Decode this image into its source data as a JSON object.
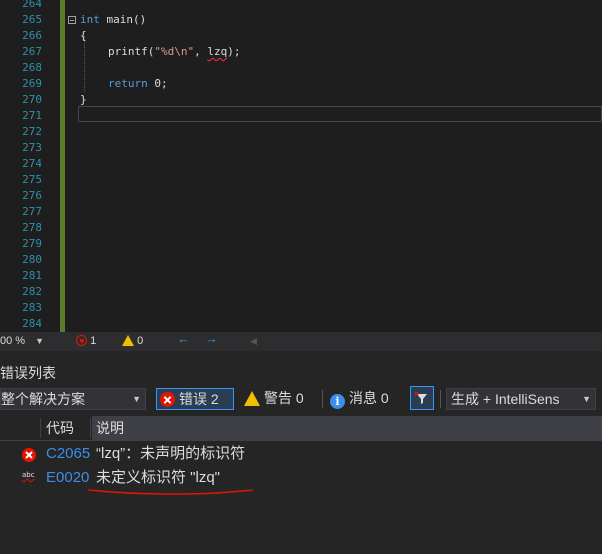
{
  "editor": {
    "line_numbers": [
      "264",
      "265",
      "266",
      "267",
      "268",
      "269",
      "270",
      "271",
      "272",
      "273",
      "274",
      "275",
      "276",
      "277",
      "278",
      "279",
      "280",
      "281",
      "282",
      "283",
      "284"
    ],
    "code": {
      "l265_keyword": "int",
      "l265_rest": " main()",
      "l266": "{",
      "l267_fn": "printf(",
      "l267_str": "\"%d\\n\"",
      "l267_sep": ", ",
      "l267_ident": "lzq",
      "l267_end": ");",
      "l269_keyword": "return",
      "l269_rest": " 0;",
      "l270": "}"
    }
  },
  "statusbar": {
    "zoom": "00 %",
    "error_count": "1",
    "warning_count": "0"
  },
  "error_list": {
    "title": "错误列表",
    "scope": "整个解决方案",
    "errors_button": "错误 2",
    "warnings_button": "警告 0",
    "messages_button": "消息 0",
    "source": "生成 + IntelliSens",
    "columns": {
      "code": "代码",
      "description": "说明"
    },
    "rows": [
      {
        "code": "C2065",
        "description": "“lzq”：未声明的标识符",
        "icon": "error-icon"
      },
      {
        "code": "E0020",
        "description": "未定义标识符 \"lzq\"",
        "icon": "intellisense-abc-icon"
      }
    ]
  },
  "colors": {
    "error": "#e51400",
    "warning": "#f0c000",
    "info": "#3c8ee8",
    "link_code": "#3c8ee8",
    "annotation": "#e51400"
  }
}
